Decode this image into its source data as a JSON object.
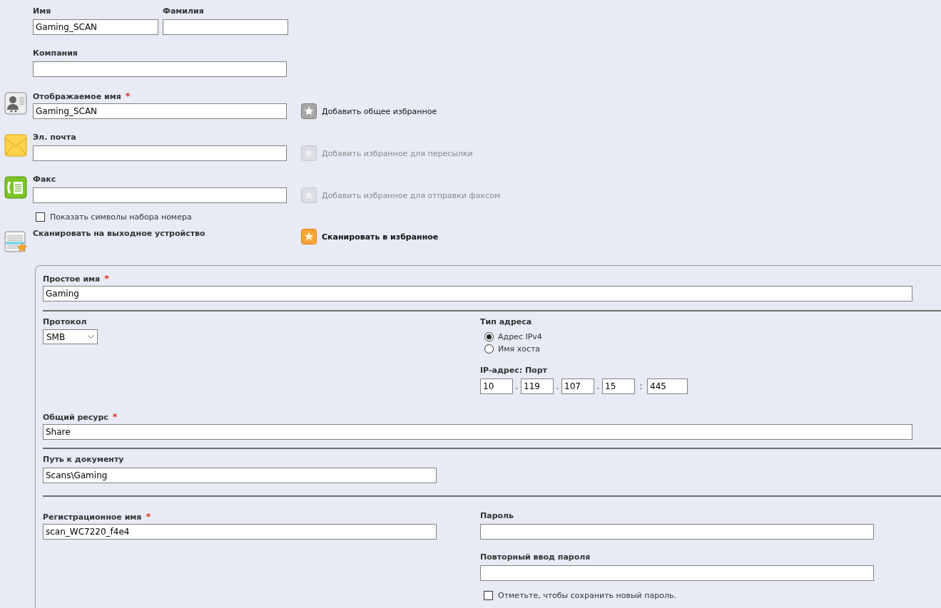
{
  "name_fields": [
    {
      "label": "Имя",
      "value": "Gaming_SCAN"
    },
    {
      "label": "Фамилия"
    }
  ],
  "company": {
    "label": "Компания"
  },
  "address_rows": [
    {
      "kind": "display",
      "label": "Отображаемое имя",
      "required_mark": "*",
      "value": "Gaming_SCAN",
      "favorite": {
        "label": "Добавить общее избранное",
        "disabled": false
      }
    },
    {
      "kind": "email",
      "label": "Эл. почта",
      "favorite": {
        "label": "Добавить избранное для пересылки",
        "disabled": true
      }
    },
    {
      "kind": "fax",
      "label": "Факс",
      "favorite": {
        "label": "Добавить избранное для отправки факсом",
        "disabled": true
      }
    }
  ],
  "dial_symbols": {
    "label": "Показать символы набора номера",
    "checked": false
  },
  "scan": {
    "label": "Сканировать на выходное устройство",
    "favorite_button": "Сканировать в избранное"
  },
  "destination": {
    "friendly_name": {
      "label": "Простое имя",
      "required_mark": "*",
      "value": "Gaming"
    },
    "protocol": {
      "label": "Протокол",
      "value": "SMB"
    },
    "address_type": {
      "label": "Тип адреса",
      "options": [
        {
          "label": "Адрес IPv4",
          "selected": true
        },
        {
          "label": "Имя хоста",
          "selected": false
        }
      ]
    },
    "ip": {
      "label": "IP-адрес: Порт",
      "octets": [
        "10",
        "119",
        "107",
        "15"
      ],
      "octet_separator": ".",
      "port_separator": ":",
      "port": "445"
    },
    "share": {
      "label": "Общий ресурс",
      "required_mark": "*",
      "value": "Share"
    },
    "path": {
      "label": "Путь к документу",
      "value": "Scans\\Gaming"
    },
    "login": {
      "label": "Регистрационное имя",
      "required_mark": "*",
      "value": "scan_WC7220_f4e4"
    },
    "password": {
      "label": "Пароль"
    },
    "password_confirm": {
      "label": "Повторный ввод пароля"
    },
    "save_password": {
      "label": "Отметьте, чтобы сохранить новый пароль.",
      "checked": false
    }
  }
}
